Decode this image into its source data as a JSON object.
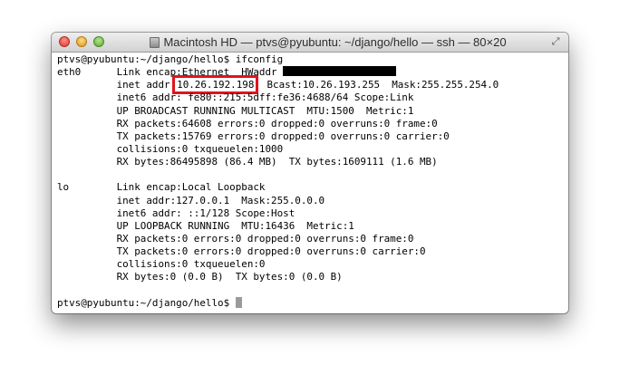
{
  "window": {
    "title": "Macintosh HD — ptvs@pyubuntu: ~/django/hello — ssh — 80×20",
    "disk_icon": "disk-icon",
    "fullscreen_icon": "fullscreen-icon"
  },
  "terminal": {
    "line_00": "ptvs@pyubuntu:~/django/hello$ ifconfig",
    "line_01_prefix": "eth0      Link encap:Ethernet  HWaddr ",
    "line_02_prefix": "          inet addr:",
    "line_02_ip": "10.26.192.198",
    "line_02_suffix": "  Bcast:10.26.193.255  Mask:255.255.254.0",
    "line_03": "          inet6 addr: fe80::215:5dff:fe36:4688/64 Scope:Link",
    "line_04": "          UP BROADCAST RUNNING MULTICAST  MTU:1500  Metric:1",
    "line_05": "          RX packets:64608 errors:0 dropped:0 overruns:0 frame:0",
    "line_06": "          TX packets:15769 errors:0 dropped:0 overruns:0 carrier:0",
    "line_07": "          collisions:0 txqueuelen:1000",
    "line_08": "          RX bytes:86495898 (86.4 MB)  TX bytes:1609111 (1.6 MB)",
    "line_09": "",
    "line_10": "lo        Link encap:Local Loopback",
    "line_11": "          inet addr:127.0.0.1  Mask:255.0.0.0",
    "line_12": "          inet6 addr: ::1/128 Scope:Host",
    "line_13": "          UP LOOPBACK RUNNING  MTU:16436  Metric:1",
    "line_14": "          RX packets:0 errors:0 dropped:0 overruns:0 frame:0",
    "line_15": "          TX packets:0 errors:0 dropped:0 overruns:0 carrier:0",
    "line_16": "          collisions:0 txqueuelen:0",
    "line_17": "          RX bytes:0 (0.0 B)  TX bytes:0 (0.0 B)",
    "line_18": "",
    "line_19": "ptvs@pyubuntu:~/django/hello$ "
  },
  "colors": {
    "highlight_box": "#e0141c",
    "redaction": "#000000",
    "cursor": "#9a9a9a"
  }
}
